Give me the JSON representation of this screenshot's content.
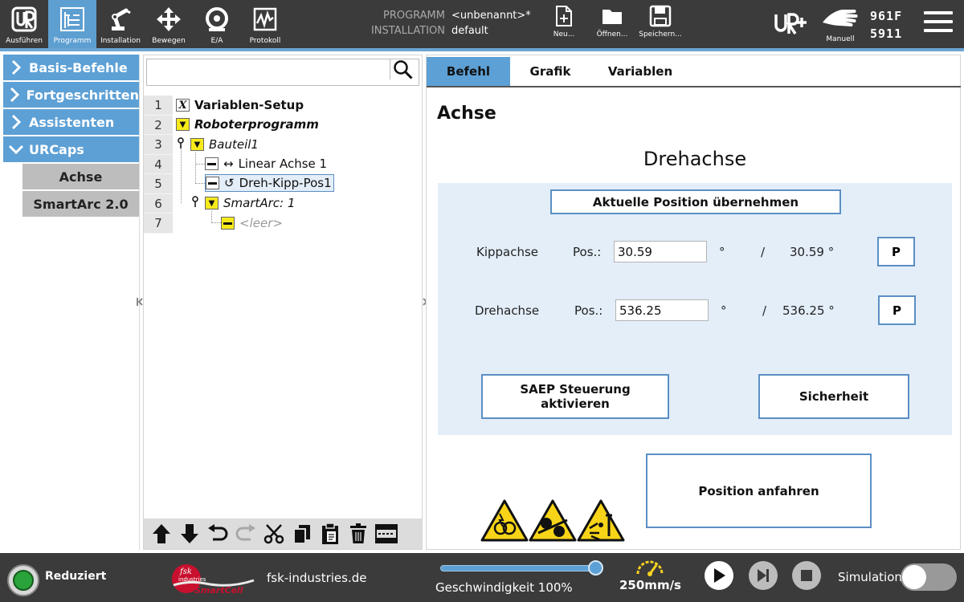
{
  "topbar": {
    "nav": [
      {
        "label": "Ausführen",
        "icon": "ur-logo-icon"
      },
      {
        "label": "Programm",
        "icon": "program-icon",
        "active": true
      },
      {
        "label": "Installation",
        "icon": "robot-arm-icon"
      },
      {
        "label": "Bewegen",
        "icon": "move-arrows-icon"
      },
      {
        "label": "E/A",
        "icon": "io-icon"
      },
      {
        "label": "Protokoll",
        "icon": "log-icon"
      }
    ],
    "program_key": "PROGRAMM",
    "program_value": "<unbenannt>*",
    "installation_key": "INSTALLATION",
    "installation_value": "default",
    "file_buttons": [
      {
        "label": "Neu...",
        "icon": "new-file-icon"
      },
      {
        "label": "Öffnen...",
        "icon": "folder-icon"
      },
      {
        "label": "Speichern...",
        "icon": "save-icon"
      }
    ],
    "mode_label": "Manuell",
    "id_line1": "961F",
    "id_line2": "5911"
  },
  "left_panel": {
    "categories": [
      {
        "label": "Basis-Befehle",
        "expanded": false
      },
      {
        "label": "Fortgeschritten",
        "expanded": false
      },
      {
        "label": "Assistenten",
        "expanded": false
      },
      {
        "label": "URCaps",
        "expanded": true
      }
    ],
    "subitems": [
      "Achse",
      "SmartArc 2.0"
    ]
  },
  "tree": {
    "line_numbers": [
      "1",
      "2",
      "3",
      "4",
      "5",
      "6",
      "7"
    ],
    "nodes": [
      {
        "label": "Variablen-Setup"
      },
      {
        "label": "Roboterprogramm"
      },
      {
        "label": "Bauteil1"
      },
      {
        "label": "Linear Achse 1"
      },
      {
        "label": "Dreh-Kipp-Pos1"
      },
      {
        "label": "SmartArc: 1"
      },
      {
        "label": "<leer>"
      }
    ]
  },
  "right_panel": {
    "tabs": [
      "Befehl",
      "Grafik",
      "Variablen"
    ],
    "title": "Achse",
    "heading": "Drehachse",
    "take_position_button": "Aktuelle Position übernehmen",
    "rows": [
      {
        "label": "Kippachse",
        "pos_label": "Pos.:",
        "value": "30.59",
        "unit": "°",
        "sep": "/",
        "current": "30.59 °",
        "button": "P"
      },
      {
        "label": "Drehachse",
        "pos_label": "Pos.:",
        "value": "536.25",
        "unit": "°",
        "sep": "/",
        "current": "536.25 °",
        "button": "P"
      }
    ],
    "saep_button": "SAEP Steuerung aktivieren",
    "safety_button": "Sicherheit",
    "move_button": "Position anfahren",
    "warning_icons": [
      "warning-entanglement-icon",
      "warning-crush-rollers-icon",
      "warning-impact-icon"
    ]
  },
  "footer": {
    "status": "Reduziert",
    "status_color": "#2aa33a",
    "logo_text_top": "fsk",
    "logo_text_mid": "industries",
    "logo_text_bottom": "SmartCell",
    "website": "fsk-industries.de",
    "speed_label": "Geschwindigkeit 100%",
    "speed_fraction": 1.0,
    "tcp_speed": "250mm/s",
    "simulation_label": "Simulation",
    "simulation_on": false
  }
}
